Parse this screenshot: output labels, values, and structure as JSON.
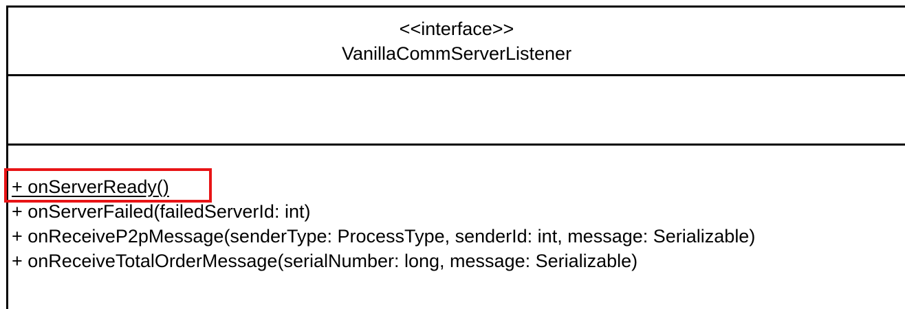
{
  "diagram": {
    "type": "uml-class",
    "stereotype": "<<interface>>",
    "class_name": "VanillaCommServerListener",
    "attributes": [],
    "methods": [
      {
        "text": "+ onServerReady()",
        "underlined": true,
        "highlighted": true
      },
      {
        "text": "+ onServerFailed(failedServerId: int)"
      },
      {
        "text": "+ onReceiveP2pMessage(senderType: ProcessType, senderId: int, message: Serializable)"
      },
      {
        "text": "+ onReceiveTotalOrderMessage(serialNumber: long, message: Serializable)"
      }
    ]
  },
  "colors": {
    "line": "#000000",
    "highlight": "#e81416",
    "background": "#ffffff"
  }
}
